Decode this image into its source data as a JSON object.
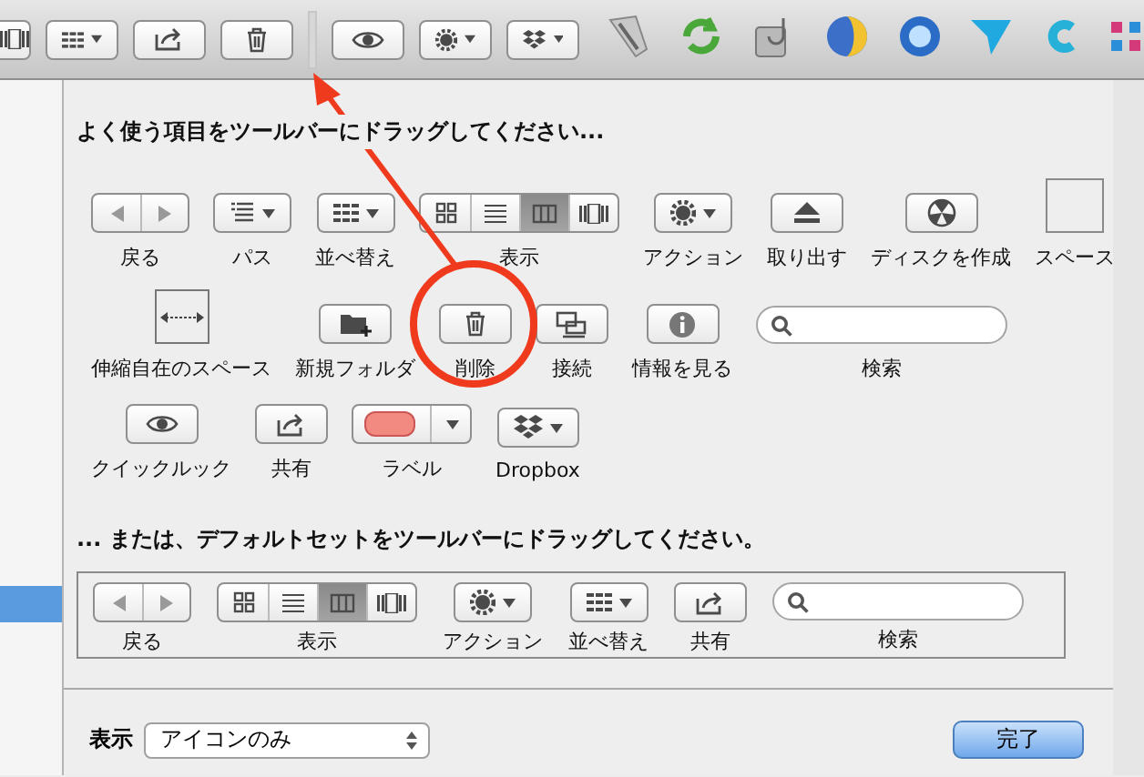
{
  "window_toolbar": {
    "items": [
      {
        "kind": "view-partial"
      },
      {
        "kind": "arrange"
      },
      {
        "kind": "share"
      },
      {
        "kind": "delete"
      },
      {
        "kind": "blank"
      },
      {
        "kind": "quicklook"
      },
      {
        "kind": "action"
      },
      {
        "kind": "dropbox"
      },
      {
        "kind": "pen"
      },
      {
        "kind": "sync"
      },
      {
        "kind": "disk"
      },
      {
        "kind": "globe"
      },
      {
        "kind": "ring"
      },
      {
        "kind": "triangle"
      },
      {
        "kind": "crescent"
      },
      {
        "kind": "pinwheel"
      }
    ]
  },
  "sheet": {
    "title": "よく使う項目をツールバーにドラッグしてください...",
    "palette": [
      {
        "items": [
          {
            "kind": "nav",
            "label": "戻る"
          },
          {
            "kind": "path",
            "label": "パス"
          },
          {
            "kind": "arrange",
            "label": "並べ替え"
          },
          {
            "kind": "view",
            "label": "表示",
            "segments": [
              {
                "selected": false
              },
              {
                "selected": false
              },
              {
                "selected": true
              },
              {
                "selected": false
              }
            ]
          },
          {
            "kind": "action",
            "label": "アクション"
          },
          {
            "kind": "eject",
            "label": "取り出す"
          },
          {
            "kind": "burn",
            "label": "ディスクを作成"
          },
          {
            "kind": "space",
            "label": "スペース"
          }
        ]
      },
      {
        "items": [
          {
            "kind": "flexspace",
            "label": "伸縮自在のスペース"
          },
          {
            "kind": "newfolder",
            "label": "新規フォルダ"
          },
          {
            "kind": "delete",
            "label": "削除"
          },
          {
            "kind": "connect",
            "label": "接続"
          },
          {
            "kind": "info",
            "label": "情報を見る"
          },
          {
            "kind": "search",
            "label": "検索"
          }
        ]
      },
      {
        "items": [
          {
            "kind": "quicklook",
            "label": "クイックルック"
          },
          {
            "kind": "share",
            "label": "共有"
          },
          {
            "kind": "label",
            "label": "ラベル"
          },
          {
            "kind": "dropbox",
            "label": "Dropbox"
          }
        ]
      }
    ],
    "default_title": "... または、デフォルトセットをツールバーにドラッグしてください。",
    "default_set": [
      {
        "kind": "nav",
        "label": "戻る"
      },
      {
        "kind": "view",
        "label": "表示",
        "segments": [
          {
            "selected": false
          },
          {
            "selected": false
          },
          {
            "selected": true
          },
          {
            "selected": false
          }
        ]
      },
      {
        "kind": "action",
        "label": "アクション"
      },
      {
        "kind": "arrange",
        "label": "並べ替え"
      },
      {
        "kind": "share",
        "label": "共有"
      },
      {
        "kind": "search",
        "label": "検索"
      }
    ],
    "show_label": "表示",
    "show_value": "アイコンのみ",
    "done_button": "完了"
  }
}
